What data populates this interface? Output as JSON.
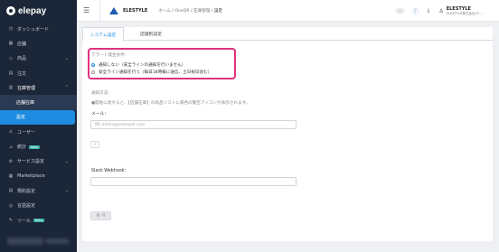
{
  "sidebar": {
    "logo": "elepay",
    "items": [
      {
        "label": "ダッシュボード",
        "icon": "clock-icon"
      },
      {
        "label": "店舗",
        "icon": "store-icon"
      },
      {
        "label": "商品",
        "icon": "tag-icon",
        "expandable": true
      },
      {
        "label": "注文",
        "icon": "cart-icon"
      },
      {
        "label": "在庫管理",
        "icon": "inventory-icon",
        "expanded": true
      },
      {
        "label": "店舗在庫"
      },
      {
        "label": "設定",
        "active": true
      },
      {
        "label": "ユーザー",
        "icon": "user-icon"
      },
      {
        "label": "統計",
        "icon": "chart-icon",
        "badge": "beta"
      },
      {
        "label": "サービス設定",
        "icon": "gear-icon",
        "expandable": true
      },
      {
        "label": "Marketplace",
        "icon": "grid-icon"
      },
      {
        "label": "規約設定",
        "icon": "doc-icon",
        "expandable": true
      },
      {
        "label": "言語設定",
        "icon": "globe-icon"
      },
      {
        "label": "ツール",
        "icon": "wrench-icon",
        "badge": "beta"
      }
    ]
  },
  "header": {
    "brand": "ELESTYLE",
    "breadcrumb": [
      "ホーム",
      "OneQR",
      "在庫管理",
      "設定"
    ],
    "account_name": "ELESTYLE",
    "account_sub": "ELESTYLE株式会社(テ..."
  },
  "tabs": [
    "システム設定",
    "店舗別設定"
  ],
  "alert": {
    "title": "アラート発生条件：",
    "options": [
      {
        "label": "通知しない（安全ラインの通知を行いません）",
        "selected": true
      },
      {
        "label": "安全ライン通知を行う（毎日18時毎に送信、土日祝日含む）",
        "selected": false
      }
    ]
  },
  "notify": {
    "title": "通知方法：",
    "description": "●開始に達すると、【店舗在庫】の商品リストに黄色の警告アイコンが表示されます。",
    "email_label": "メール：",
    "email_placeholder": "例) admin@example.com",
    "add_label": "+",
    "slack_label": "Slack Webhook：",
    "slack_value": ""
  },
  "save_label": "保 存",
  "colors": {
    "sidebar_bg": "#1b2638",
    "active": "#1e8ce0",
    "highlight_border": "#e0317e"
  }
}
